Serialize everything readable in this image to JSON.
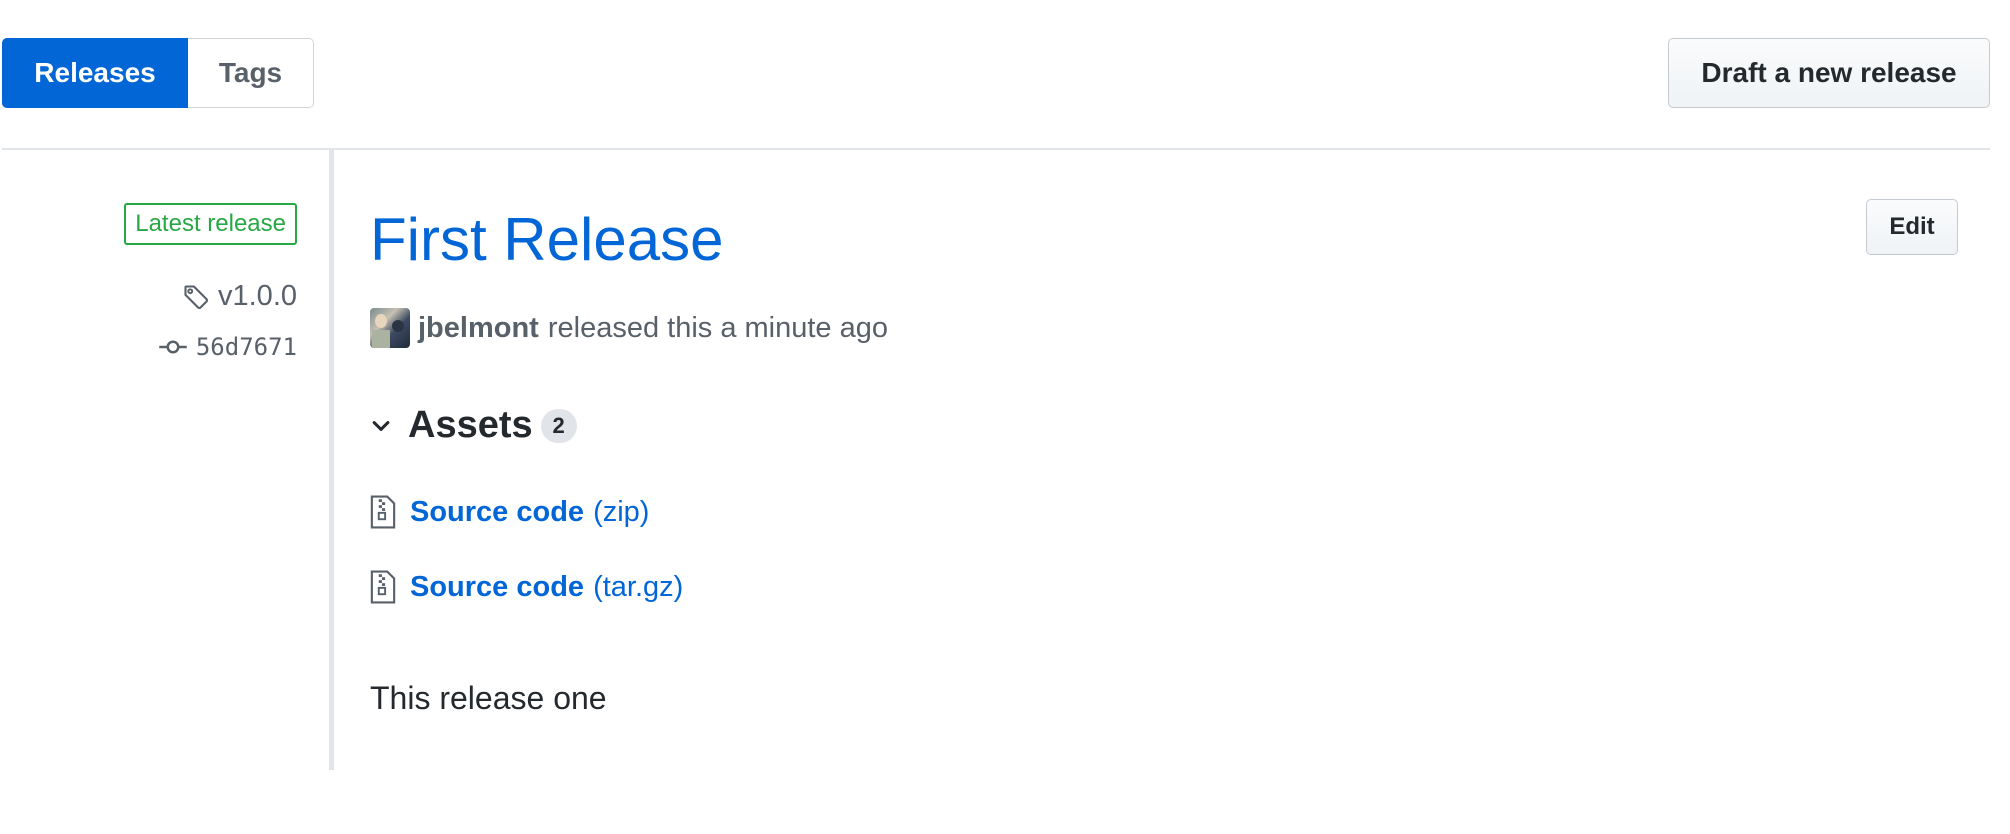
{
  "tabs": {
    "releases_label": "Releases",
    "tags_label": "Tags"
  },
  "draft_button_label": "Draft a new release",
  "sidebar": {
    "latest_badge": "Latest release",
    "tag": "v1.0.0",
    "commit": "56d7671"
  },
  "release": {
    "title": "First Release",
    "edit_label": "Edit",
    "author": "jbelmont",
    "released_text": "released this a minute ago",
    "assets_title": "Assets",
    "assets_count": "2",
    "assets": [
      {
        "name": "Source code",
        "ext": "(zip)"
      },
      {
        "name": "Source code",
        "ext": "(tar.gz)"
      }
    ],
    "notes": "This release one"
  },
  "colors": {
    "accent": "#0366d6",
    "success": "#28a745",
    "muted_text": "#586069",
    "border": "#e1e4e8"
  },
  "icons": [
    "tag-icon",
    "commit-icon",
    "chevron-down-icon",
    "file-zip-icon"
  ]
}
